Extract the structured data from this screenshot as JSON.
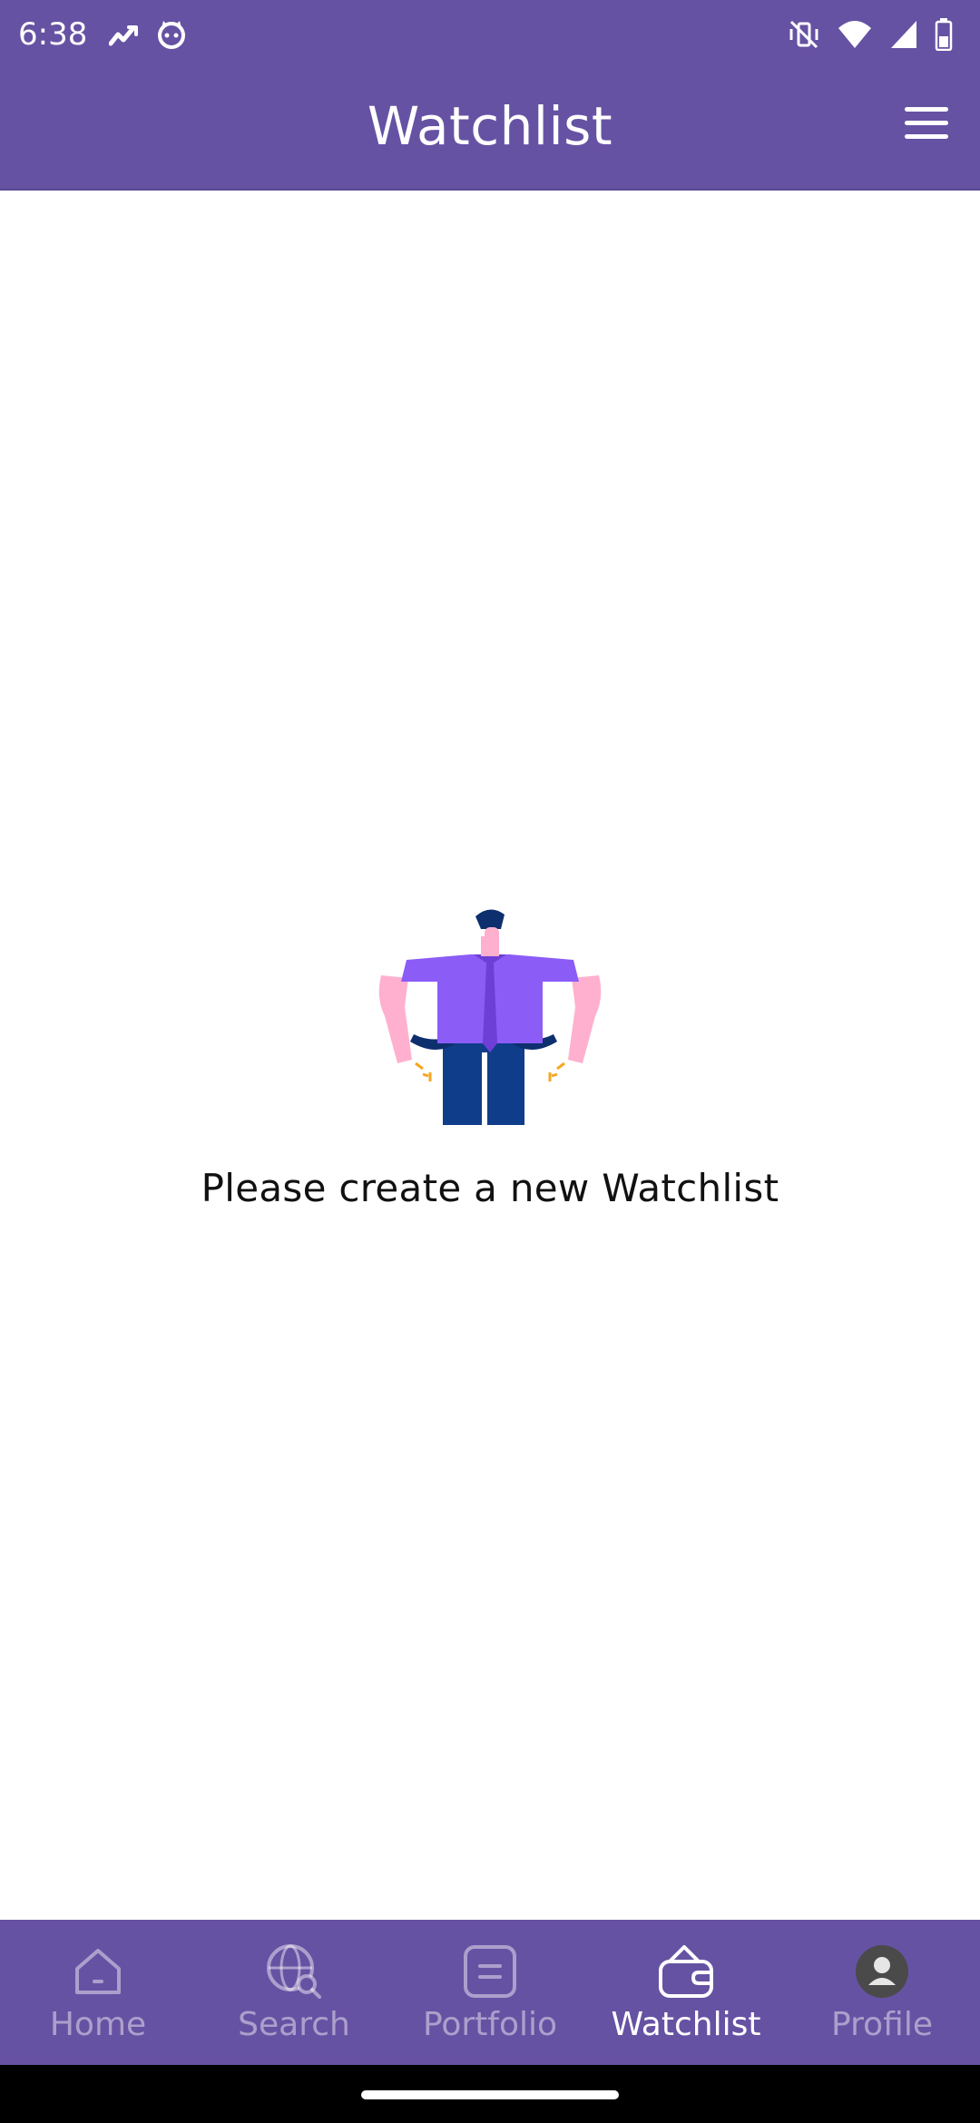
{
  "status_bar": {
    "time": "6:38",
    "left_icons": [
      "stock-trend-icon",
      "cat-face-icon"
    ],
    "right_icons": [
      "mute-vibrate-icon",
      "wifi-icon",
      "cell-signal-icon",
      "battery-icon"
    ]
  },
  "app_bar": {
    "title": "Watchlist",
    "menu_icon": "hamburger-menu-icon"
  },
  "empty_state": {
    "illustration": "empty-pockets-man-illustration",
    "message": "Please create a new Watchlist"
  },
  "bottom_nav": {
    "active_index": 3,
    "items": [
      {
        "label": "Home",
        "icon": "home-icon"
      },
      {
        "label": "Search",
        "icon": "globe-search-icon"
      },
      {
        "label": "Portfolio",
        "icon": "portfolio-icon"
      },
      {
        "label": "Watchlist",
        "icon": "wallet-icon"
      },
      {
        "label": "Profile",
        "icon": "profile-avatar-icon"
      }
    ]
  },
  "colors": {
    "primary": "#6652a3",
    "nav_inactive": "rgba(255,255,255,0.45)",
    "nav_active": "#ffffff",
    "text": "#111111"
  }
}
